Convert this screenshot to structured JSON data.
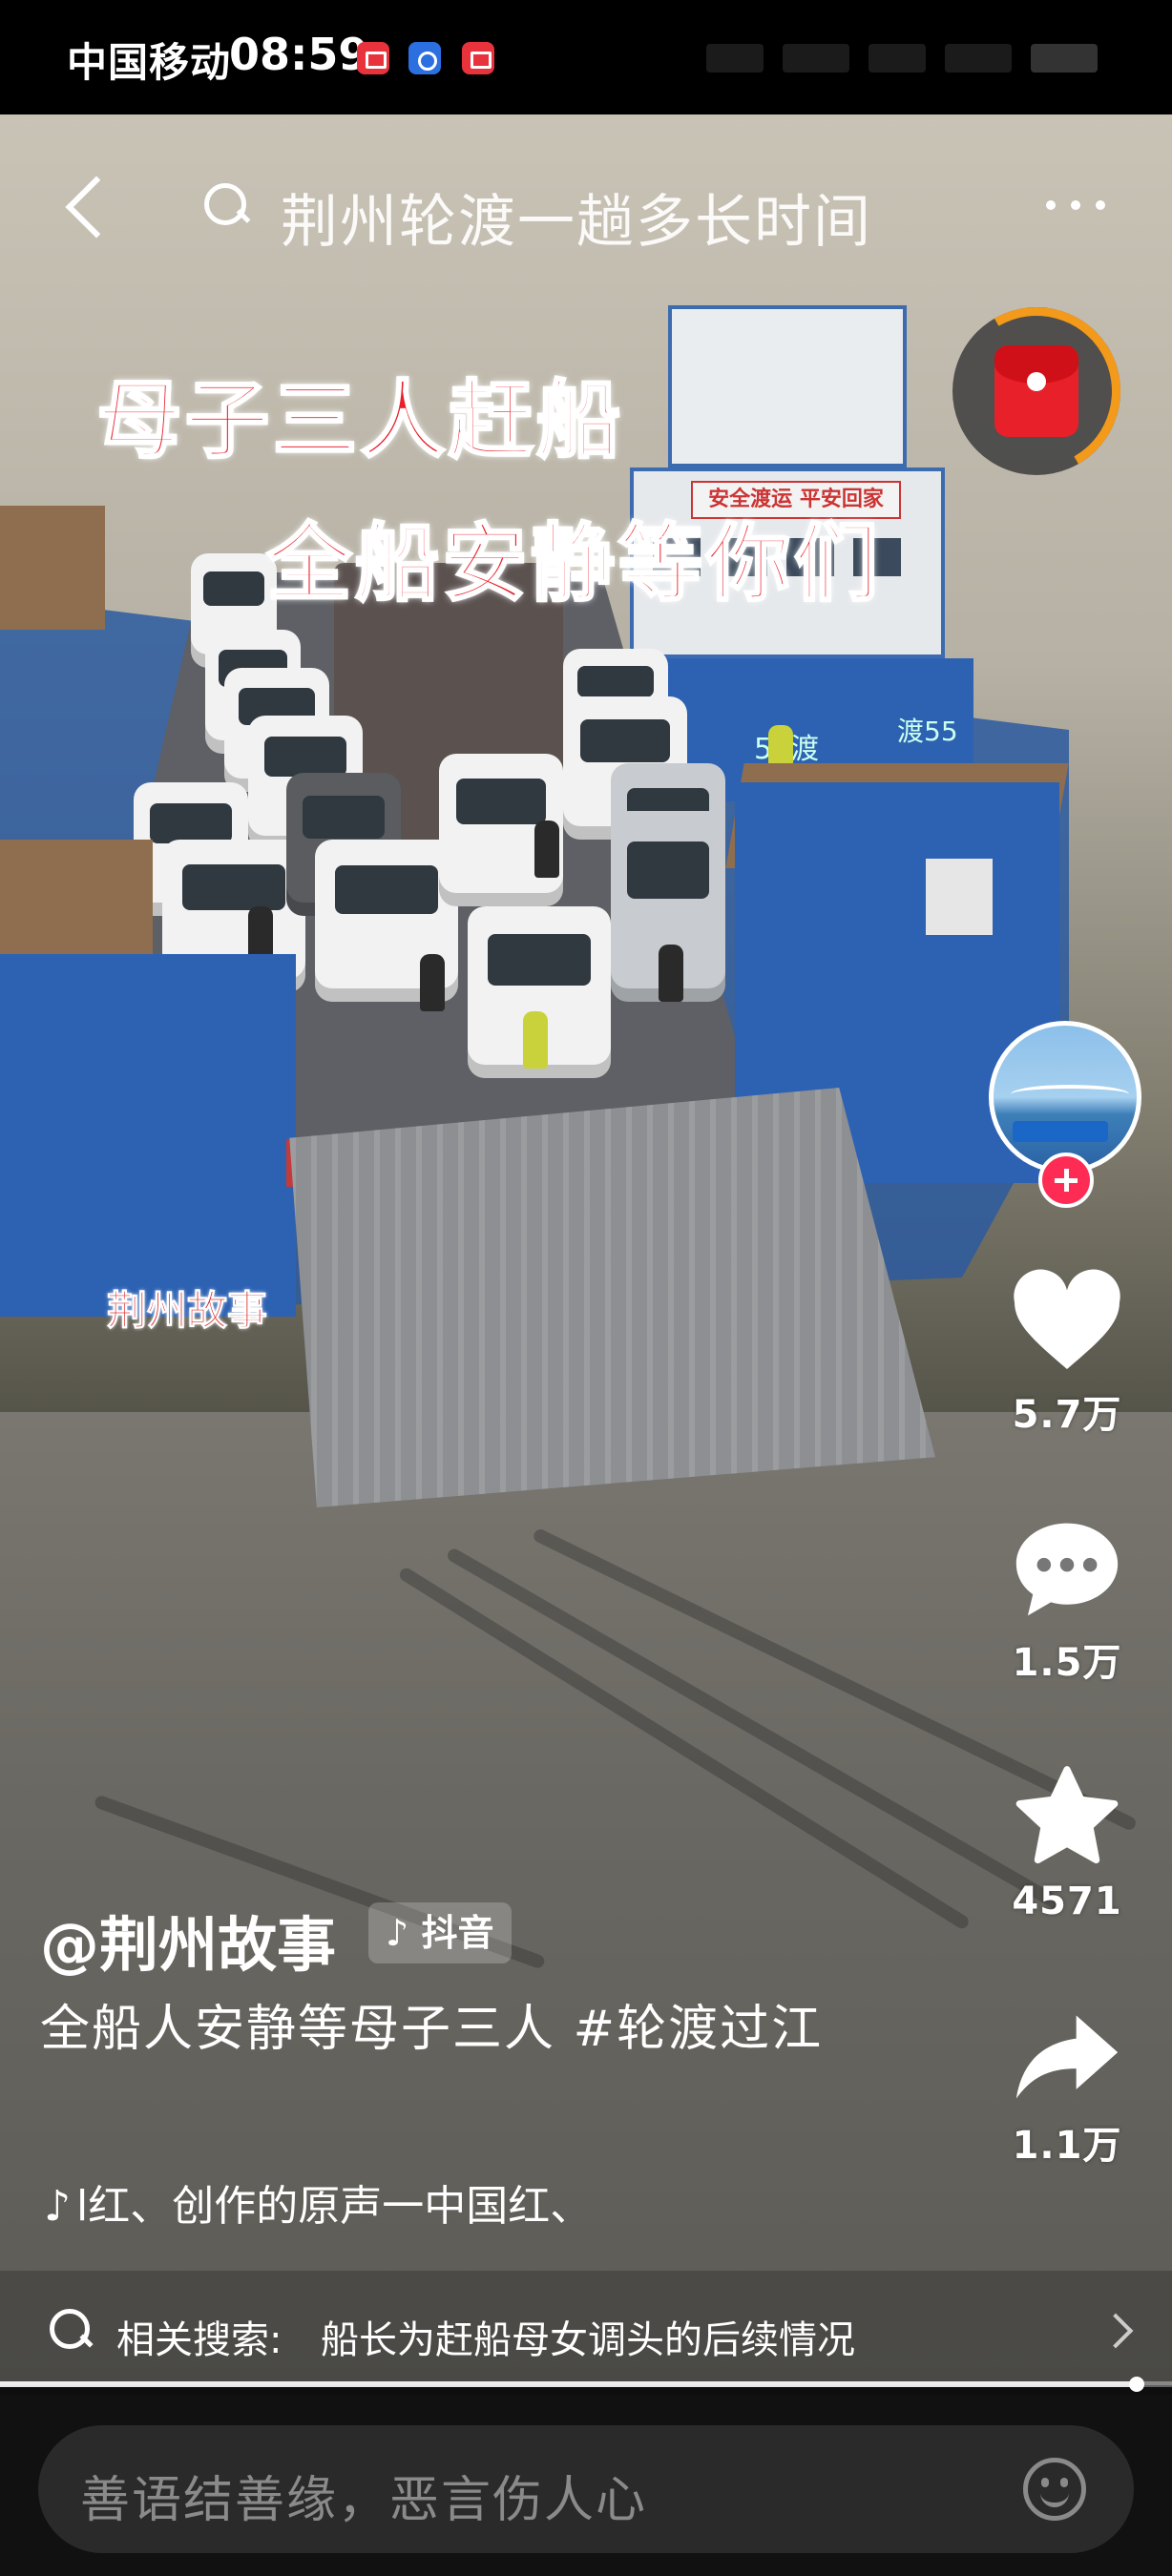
{
  "status_bar": {
    "carrier": "中国移动",
    "time": "08:59",
    "notification_icons": [
      "app-notification-icon",
      "app-notification-icon",
      "app-notification-icon"
    ]
  },
  "top_bar": {
    "search_query": "荆州轮渡一趟多长时间",
    "icons": [
      "back-icon",
      "search-icon",
      "more-icon"
    ]
  },
  "video": {
    "headline_line1": "母子三人赶船",
    "headline_line2": "全船安静等你们",
    "watermark": "荆州故事",
    "ferry_banner": "安全渡运 平安回家",
    "hull_number": "55渡",
    "hull_number_2": "渡55"
  },
  "actions": {
    "likes": "5.7万",
    "comments": "1.5万",
    "favorites": "4571",
    "shares": "1.1万"
  },
  "description": {
    "author": "@荆州故事",
    "platform_badge": "抖音",
    "caption": "全船人安静等母子三人 #轮渡过江",
    "music": "l红、创作的原声一中国红、"
  },
  "related_search": {
    "prefix": "相关搜索:",
    "query": "船长为赶船母女调头的后续情况"
  },
  "progress": {
    "played_fraction": 0.97
  },
  "comment_bar": {
    "placeholder": "善语结善缘，恶言伤人心"
  },
  "colors": {
    "accent_red": "#e8202a",
    "follow_pink": "#fe2c55",
    "redpacket_ring": "#f39a1b",
    "ferry_blue": "#2d62b3"
  }
}
